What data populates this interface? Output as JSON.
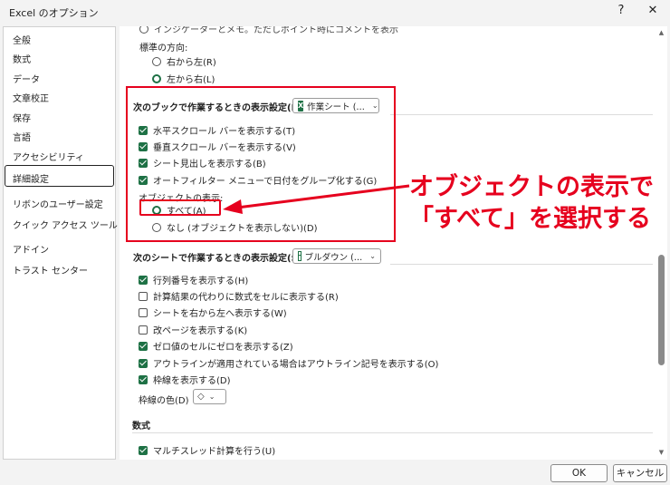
{
  "window": {
    "title": "Excel のオプション",
    "help_glyph": "?",
    "close_glyph": "✕"
  },
  "sidebar": {
    "items": [
      {
        "label": "全般"
      },
      {
        "label": "数式"
      },
      {
        "label": "データ"
      },
      {
        "label": "文章校正"
      },
      {
        "label": "保存"
      },
      {
        "label": "言語"
      },
      {
        "label": "アクセシビリティ"
      },
      {
        "label": "詳細設定",
        "selected": true
      },
      {
        "label": "リボンのユーザー設定"
      },
      {
        "label": "クイック アクセス ツール バー"
      },
      {
        "label": "アドイン"
      },
      {
        "label": "トラスト センター"
      }
    ]
  },
  "main": {
    "top_cut_text": "インジケーターとメモ。ただしポイント時にコメントを表示",
    "direction_label": "標準の方向:",
    "direction_options": [
      {
        "label": "右から左(R)",
        "checked": false
      },
      {
        "label": "左から右(L)",
        "checked": true
      }
    ],
    "workbook_section": {
      "title": "次のブックで作業するときの表示設定(B):",
      "combo_value": "作業シート (…"
    },
    "workbook_options": [
      {
        "label": "水平スクロール バーを表示する(T)",
        "checked": true
      },
      {
        "label": "垂直スクロール バーを表示する(V)",
        "checked": true
      },
      {
        "label": "シート見出しを表示する(B)",
        "checked": true
      },
      {
        "label": "オートフィルター メニューで日付をグループ化する(G)",
        "checked": true
      }
    ],
    "object_display_label": "オブジェクトの表示:",
    "object_display_options": [
      {
        "label": "すべて(A)",
        "checked": true
      },
      {
        "label": "なし (オブジェクトを表示しない)(D)",
        "checked": false
      }
    ],
    "sheet_section": {
      "title": "次のシートで作業するときの表示設定(S):",
      "combo_value": "ブルダウン (…"
    },
    "sheet_options": [
      {
        "label": "行列番号を表示する(H)",
        "checked": true
      },
      {
        "label": "計算結果の代わりに数式をセルに表示する(R)",
        "checked": false
      },
      {
        "label": "シートを右から左へ表示する(W)",
        "checked": false
      },
      {
        "label": "改ページを表示する(K)",
        "checked": false
      },
      {
        "label": "ゼロ値のセルにゼロを表示する(Z)",
        "checked": true
      },
      {
        "label": "アウトラインが適用されている場合はアウトライン記号を表示する(O)",
        "checked": true
      },
      {
        "label": "枠線を表示する(D)",
        "checked": true
      }
    ],
    "gridline_color_label": "枠線の色(D)",
    "formulas_title": "数式",
    "formulas_options": [
      {
        "label": "マルチスレッド計算を行う(U)",
        "checked": true
      }
    ]
  },
  "annotation": {
    "line1": "オブジェクトの表示で",
    "line2": "「すべて」を選択する",
    "color": "#e6001e"
  },
  "footer": {
    "ok_label": "OK",
    "cancel_label": "キャンセル"
  },
  "colors": {
    "accent_green": "#1e7145",
    "highlight_red": "#e6001e"
  }
}
